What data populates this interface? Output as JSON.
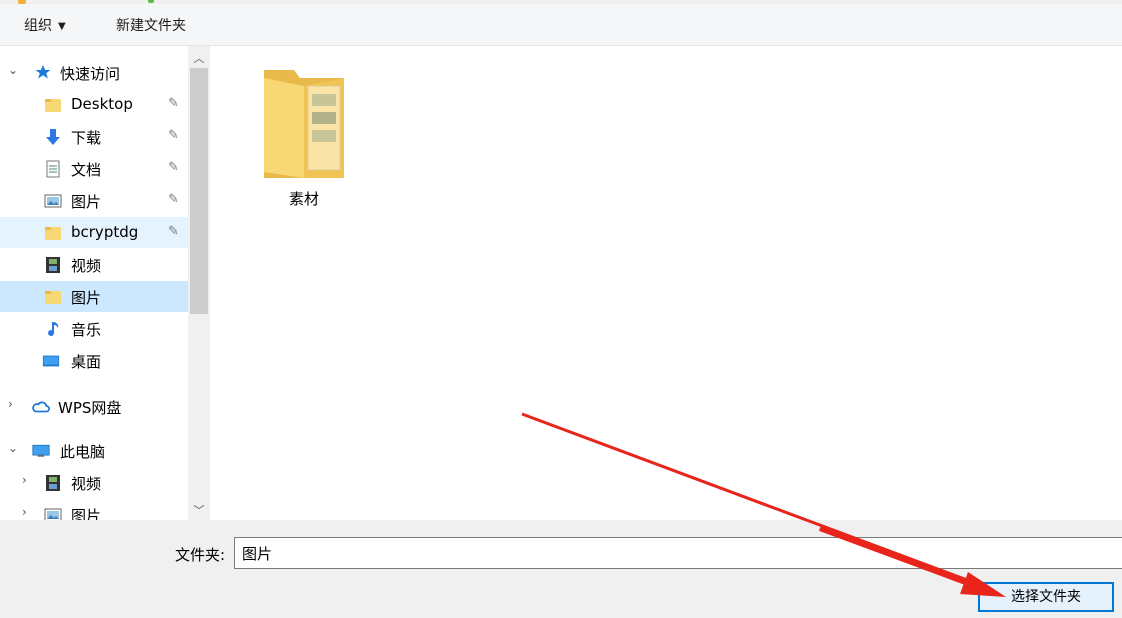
{
  "toolbar": {
    "organize": "组织",
    "new_folder": "新建文件夹"
  },
  "nav": {
    "quick_access": "快速访问",
    "items": [
      {
        "label": "Desktop"
      },
      {
        "label": "下载"
      },
      {
        "label": "文档"
      },
      {
        "label": "图片"
      },
      {
        "label": "bcryptdg"
      },
      {
        "label": "视频"
      },
      {
        "label": "图片"
      },
      {
        "label": "音乐"
      },
      {
        "label": "桌面"
      }
    ],
    "wps_drive": "WPS网盘",
    "this_pc": "此电脑",
    "pc_items": [
      {
        "label": "视频"
      },
      {
        "label": "图片"
      }
    ]
  },
  "content": {
    "items": [
      {
        "label": "素材",
        "type": "folder-icon"
      }
    ]
  },
  "footer": {
    "folder_label": "文件夹:",
    "folder_value": "图片",
    "select_button": "选择文件夹"
  },
  "colors": {
    "accent": "#0078d7",
    "selection": "#cce8ff",
    "hover": "#e5f3ff",
    "folder": "#f8d775",
    "annotation_arrow": "#e8241b"
  }
}
